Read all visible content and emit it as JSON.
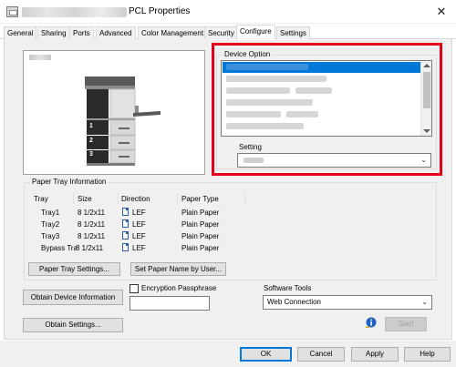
{
  "window": {
    "title": "PCL Properties",
    "close_glyph": "✕"
  },
  "tabs": [
    {
      "label": "General"
    },
    {
      "label": "Sharing"
    },
    {
      "label": "Ports"
    },
    {
      "label": "Advanced"
    },
    {
      "label": "Color Management"
    },
    {
      "label": "Security"
    },
    {
      "label": "Configure",
      "active": true
    },
    {
      "label": "Settings"
    }
  ],
  "preview": {
    "tray_numbers": [
      "1",
      "2",
      "3"
    ]
  },
  "device_option": {
    "label": "Device Option",
    "setting_label": "Setting"
  },
  "paper_tray": {
    "group_label": "Paper Tray Information",
    "columns": [
      "Tray",
      "Size",
      "Direction",
      "Paper Type"
    ],
    "rows": [
      {
        "tray": "Tray1",
        "size": "8 1/2x11",
        "direction": "LEF",
        "type": "Plain Paper"
      },
      {
        "tray": "Tray2",
        "size": "8 1/2x11",
        "direction": "LEF",
        "type": "Plain Paper"
      },
      {
        "tray": "Tray3",
        "size": "8 1/2x11",
        "direction": "LEF",
        "type": "Plain Paper"
      },
      {
        "tray": "Bypass Tra",
        "size": "8 1/2x11",
        "direction": "LEF",
        "type": "Plain Paper"
      }
    ],
    "settings_button": "Paper Tray Settings...",
    "set_name_button": "Set Paper Name by User..."
  },
  "buttons": {
    "obtain_device_info": "Obtain Device Information",
    "obtain_settings": "Obtain Settings...",
    "start": "Start",
    "ok": "OK",
    "cancel": "Cancel",
    "apply": "Apply",
    "help": "Help"
  },
  "encryption": {
    "label": "Encryption Passphrase",
    "checked": false
  },
  "software_tools": {
    "label": "Software Tools",
    "selected": "Web Connection"
  },
  "colors": {
    "highlight": "#0078d7",
    "annotation_red": "#e3001b",
    "dialog_bg": "#f0f0f0"
  }
}
